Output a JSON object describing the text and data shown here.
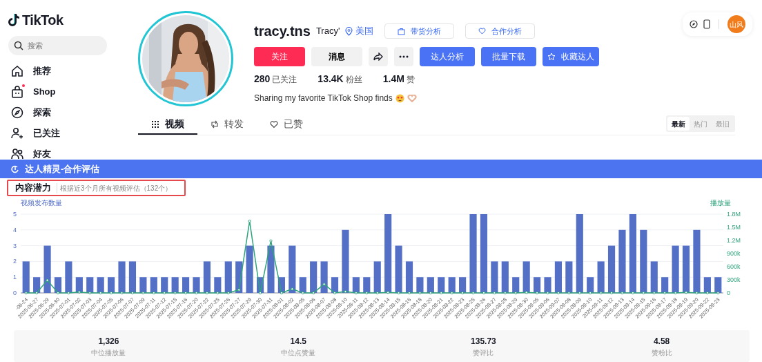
{
  "logo": "TikTok",
  "search": {
    "placeholder": "搜索"
  },
  "sidebar": {
    "items": [
      {
        "label": "推荐",
        "dot": false
      },
      {
        "label": "Shop",
        "dot": true
      },
      {
        "label": "探索",
        "dot": false
      },
      {
        "label": "已关注",
        "dot": false
      },
      {
        "label": "好友",
        "dot": false
      }
    ]
  },
  "toolbar": {
    "avatar_text": "山风"
  },
  "profile": {
    "username": "tracy.tns",
    "nickname": "Tracy'",
    "region": "美国",
    "links": [
      "带货分析",
      "合作分析"
    ],
    "buttons": [
      {
        "kind": "follow",
        "label": "关注"
      },
      {
        "kind": "message",
        "label": "消息"
      },
      {
        "kind": "share"
      },
      {
        "kind": "more"
      },
      {
        "kind": "primary",
        "label": "达人分析"
      },
      {
        "kind": "primary",
        "label": "批量下载"
      },
      {
        "kind": "star",
        "label": "收藏达人"
      }
    ],
    "stats": [
      {
        "value": "280",
        "label": "已关注"
      },
      {
        "value": "13.4K",
        "label": "粉丝"
      },
      {
        "value": "1.4M",
        "label": "赞"
      }
    ],
    "bio": "Sharing my favorite TikTok Shop finds"
  },
  "tabs": [
    {
      "label": "视频",
      "selected": true
    },
    {
      "label": "转发",
      "selected": false
    },
    {
      "label": "已赞",
      "selected": false
    }
  ],
  "sort": [
    {
      "label": "最新",
      "selected": true
    },
    {
      "label": "热门",
      "selected": false
    },
    {
      "label": "最旧",
      "selected": false
    }
  ],
  "panel": {
    "title": "达人精灵-合作评估",
    "section": {
      "title": "内容潜力",
      "note": "根据近3个月所有视频评估（132个）",
      "chart_data": {
        "type": "bar",
        "categories": [
          "-06-24",
          "2025-06-27",
          "2025-06-29",
          "2025-06-30",
          "2025-07-01",
          "2025-07-02",
          "2025-07-03",
          "2025-07-04",
          "2025-07-05",
          "2025-07-06",
          "2025-07-07",
          "2025-07-09",
          "2025-07-11",
          "2025-07-12",
          "2025-07-15",
          "2025-07-16",
          "2025-07-20",
          "2025-07-22",
          "2025-07-25",
          "2025-07-26",
          "2025-07-27",
          "2025-07-29",
          "2025-07-30",
          "2025-07-31",
          "2025-08-01",
          "2025-08-02",
          "2025-08-05",
          "2025-08-06",
          "2025-08-07",
          "2025-08-08",
          "2025-08-10",
          "2025-08-11",
          "2025-08-12",
          "2025-08-13",
          "2025-08-14",
          "2025-08-15",
          "2025-08-16",
          "2025-08-18",
          "2025-08-20",
          "2025-08-21",
          "2025-08-22",
          "2025-08-23",
          "2025-08-25",
          "2025-08-26",
          "2025-08-27",
          "2025-08-28",
          "2025-08-29",
          "2025-08-30",
          "2025-09-05",
          "2025-09-06",
          "2025-09-07",
          "2025-09-08",
          "2025-09-09",
          "2025-09-10",
          "2025-09-11",
          "2025-09-12",
          "2025-09-13",
          "2025-09-14",
          "2025-09-15",
          "2025-09-16",
          "2025-09-17",
          "2025-09-18",
          "2025-09-19",
          "2025-09-20",
          "2025-09-22",
          "2025-09-23"
        ],
        "series": [
          {
            "name": "视频发布数量",
            "color": "#5470c6",
            "values": [
              2,
              1,
              3,
              1,
              2,
              1,
              1,
              1,
              1,
              2,
              2,
              1,
              1,
              1,
              1,
              1,
              1,
              2,
              1,
              2,
              2,
              3,
              1,
              3,
              1,
              3,
              1,
              2,
              2,
              1,
              4,
              1,
              1,
              2,
              5,
              3,
              2,
              1,
              1,
              1,
              1,
              1,
              5,
              5,
              2,
              2,
              1,
              2,
              1,
              1,
              2,
              2,
              5,
              1,
              2,
              3,
              4,
              5,
              4,
              2,
              1,
              3,
              3,
              4,
              1,
              1
            ]
          }
        ],
        "grid": true,
        "ylim": [
          0,
          5
        ],
        "yticks": [
          0,
          1,
          2,
          3,
          4,
          5
        ]
      },
      "overlay": {
        "chart_data": {
          "type": "line",
          "categories": [
            null,
            null,
            null,
            null,
            null,
            null,
            null,
            null,
            null,
            null,
            null,
            null,
            null,
            null,
            null,
            null,
            null,
            null,
            null,
            null,
            null,
            null,
            null,
            null,
            null,
            null,
            null,
            null,
            null,
            null,
            null,
            null,
            null,
            null,
            null,
            null,
            null,
            null,
            null,
            null,
            null,
            null,
            null,
            null,
            null,
            null,
            null,
            null,
            null,
            null,
            null,
            null,
            null,
            null,
            null,
            null,
            null,
            null,
            null,
            null,
            null,
            null,
            null,
            null,
            null,
            null
          ],
          "series": [
            {
              "name": "播放量",
              "color": "#2fa37c",
              "marker": "o",
              "values": [
                0,
                0,
                290000,
                0,
                0,
                20000,
                0,
                0,
                0,
                0,
                0,
                0,
                0,
                0,
                0,
                0,
                0,
                0,
                0,
                0,
                70000,
                1640000,
                0,
                1190000,
                0,
                90000,
                0,
                0,
                200000,
                0,
                30000,
                0,
                0,
                0,
                10000,
                0,
                0,
                0,
                0,
                0,
                0,
                0,
                0,
                0,
                0,
                0,
                0,
                10000,
                0,
                0,
                0,
                0,
                0,
                0,
                0,
                0,
                0,
                0,
                0,
                0,
                0,
                0,
                10000,
                0,
                0,
                0
              ]
            }
          ],
          "ylim": [
            0,
            1800000
          ],
          "yticks": [
            {
              "value": 0,
              "label": "0"
            },
            {
              "value": 300000,
              "label": "300k"
            },
            {
              "value": 600000,
              "label": "600k"
            },
            {
              "value": 900000,
              "label": "900k"
            },
            {
              "value": 1200000,
              "label": "1.2M"
            },
            {
              "value": 1500000,
              "label": "1.5M"
            },
            {
              "value": 1800000,
              "label": "1.8M"
            }
          ]
        }
      }
    },
    "metrics": [
      {
        "value": "1,326",
        "label": "中位播放量"
      },
      {
        "value": "14.5",
        "label": "中位点赞量"
      },
      {
        "value": "135.73",
        "label": "赞评比"
      },
      {
        "value": "4.58",
        "label": "赞粉比"
      }
    ]
  }
}
